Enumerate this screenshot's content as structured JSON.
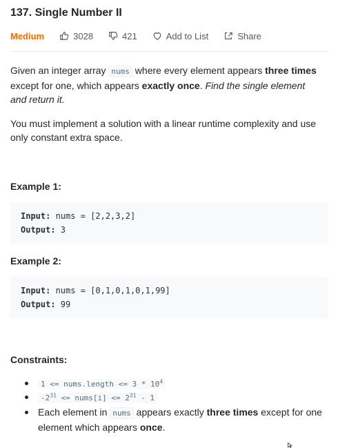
{
  "problem": {
    "title": "137. Single Number II",
    "difficulty": "Medium",
    "likes": "3028",
    "dislikes": "421",
    "add_to_list": "Add to List",
    "share": "Share"
  },
  "description": {
    "p1_a": "Given an integer array ",
    "p1_code": "nums",
    "p1_b": " where every element appears ",
    "p1_bold1": "three times",
    "p1_c": " except for one, which appears ",
    "p1_bold2": "exactly once",
    "p1_d": ". ",
    "p1_italic": "Find the single element and return it.",
    "p2": "You must implement a solution with a linear runtime complexity and use only constant extra space."
  },
  "examples": [
    {
      "heading": "Example 1:",
      "input_label": "Input:",
      "input_value": " nums = [2,2,3,2]",
      "output_label": "Output:",
      "output_value": " 3"
    },
    {
      "heading": "Example 2:",
      "input_label": "Input:",
      "input_value": " nums = [0,1,0,1,0,1,99]",
      "output_label": "Output:",
      "output_value": " 99"
    }
  ],
  "constraints": {
    "heading": "Constraints:",
    "c1_a": "1 <= nums.length <= 3 * 10",
    "c1_exp": "4",
    "c2_a": "-2",
    "c2_exp1": "31",
    "c2_b": " <= nums[i] <= 2",
    "c2_exp2": "31",
    "c2_c": " - 1",
    "c3_a": "Each element in ",
    "c3_code": "nums",
    "c3_b": " appears exactly ",
    "c3_bold1": "three times",
    "c3_c": " except for one element which appears ",
    "c3_bold2": "once",
    "c3_d": "."
  },
  "colors": {
    "difficulty_medium": "#ef6c00",
    "text": "#262626",
    "code_bg": "#f7f9fa"
  },
  "icons": [
    "thumbs-up-icon",
    "thumbs-down-icon",
    "heart-icon",
    "share-icon",
    "cursor-icon"
  ]
}
